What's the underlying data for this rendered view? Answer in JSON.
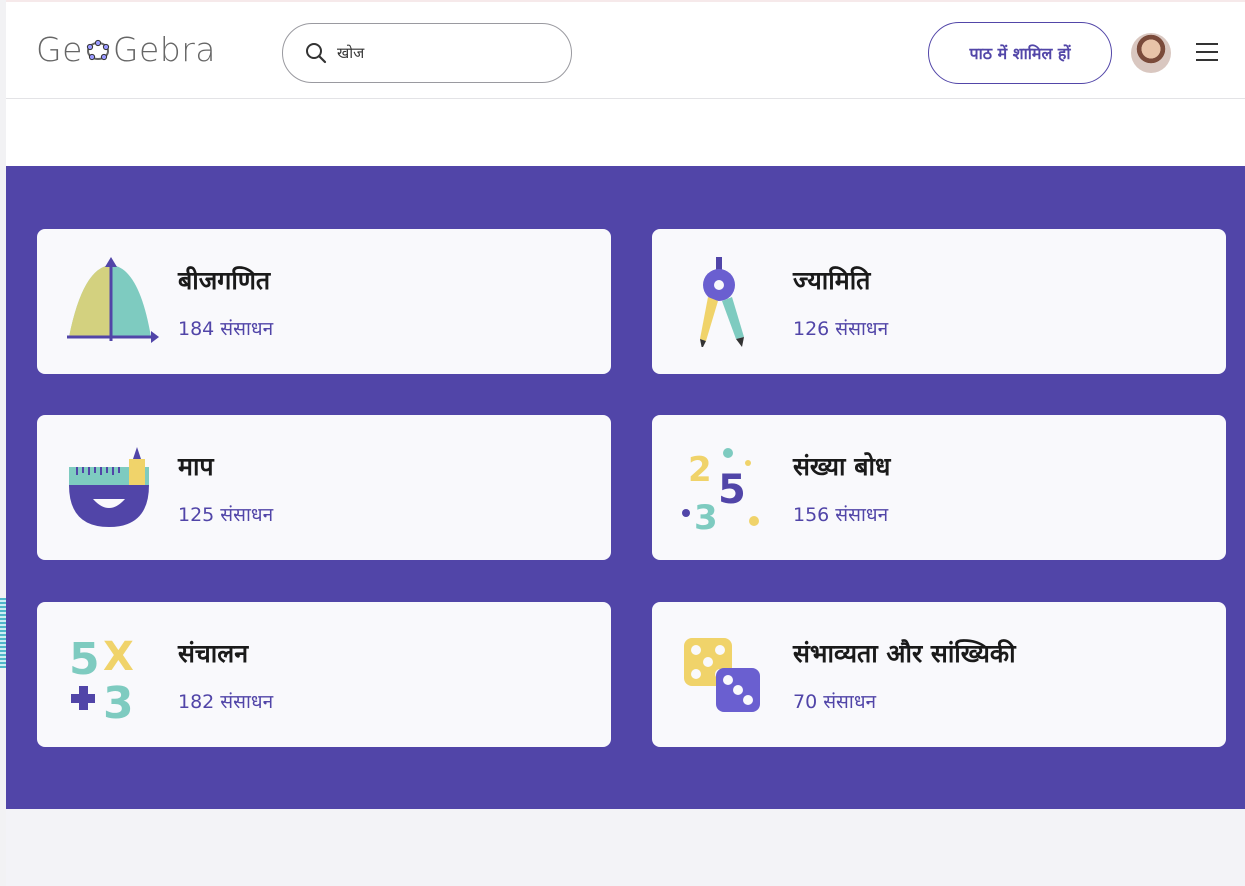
{
  "header": {
    "logo_text_pre": "Ge",
    "logo_text_post": "Gebra",
    "search_placeholder": "खोज",
    "join_button": "पाठ में शामिल हों"
  },
  "colors": {
    "brand_purple": "#5145a8",
    "card_bg": "#f9f9fc",
    "count_text": "#5145a8"
  },
  "categories": [
    {
      "title": "बीजगणित",
      "count": "184 संसाधन",
      "icon": "algebra-icon"
    },
    {
      "title": "ज्यामिति",
      "count": "126 संसाधन",
      "icon": "compass-icon"
    },
    {
      "title": "माप",
      "count": "125 संसाधन",
      "icon": "ruler-icon"
    },
    {
      "title": "संख्या बोध",
      "count": "156 संसाधन",
      "icon": "numbers-icon"
    },
    {
      "title": "संचालन",
      "count": "182 संसाधन",
      "icon": "operations-icon"
    },
    {
      "title": "संभाव्यता और सांख्यिकी",
      "count": "70 संसाधन",
      "icon": "dice-icon"
    }
  ]
}
